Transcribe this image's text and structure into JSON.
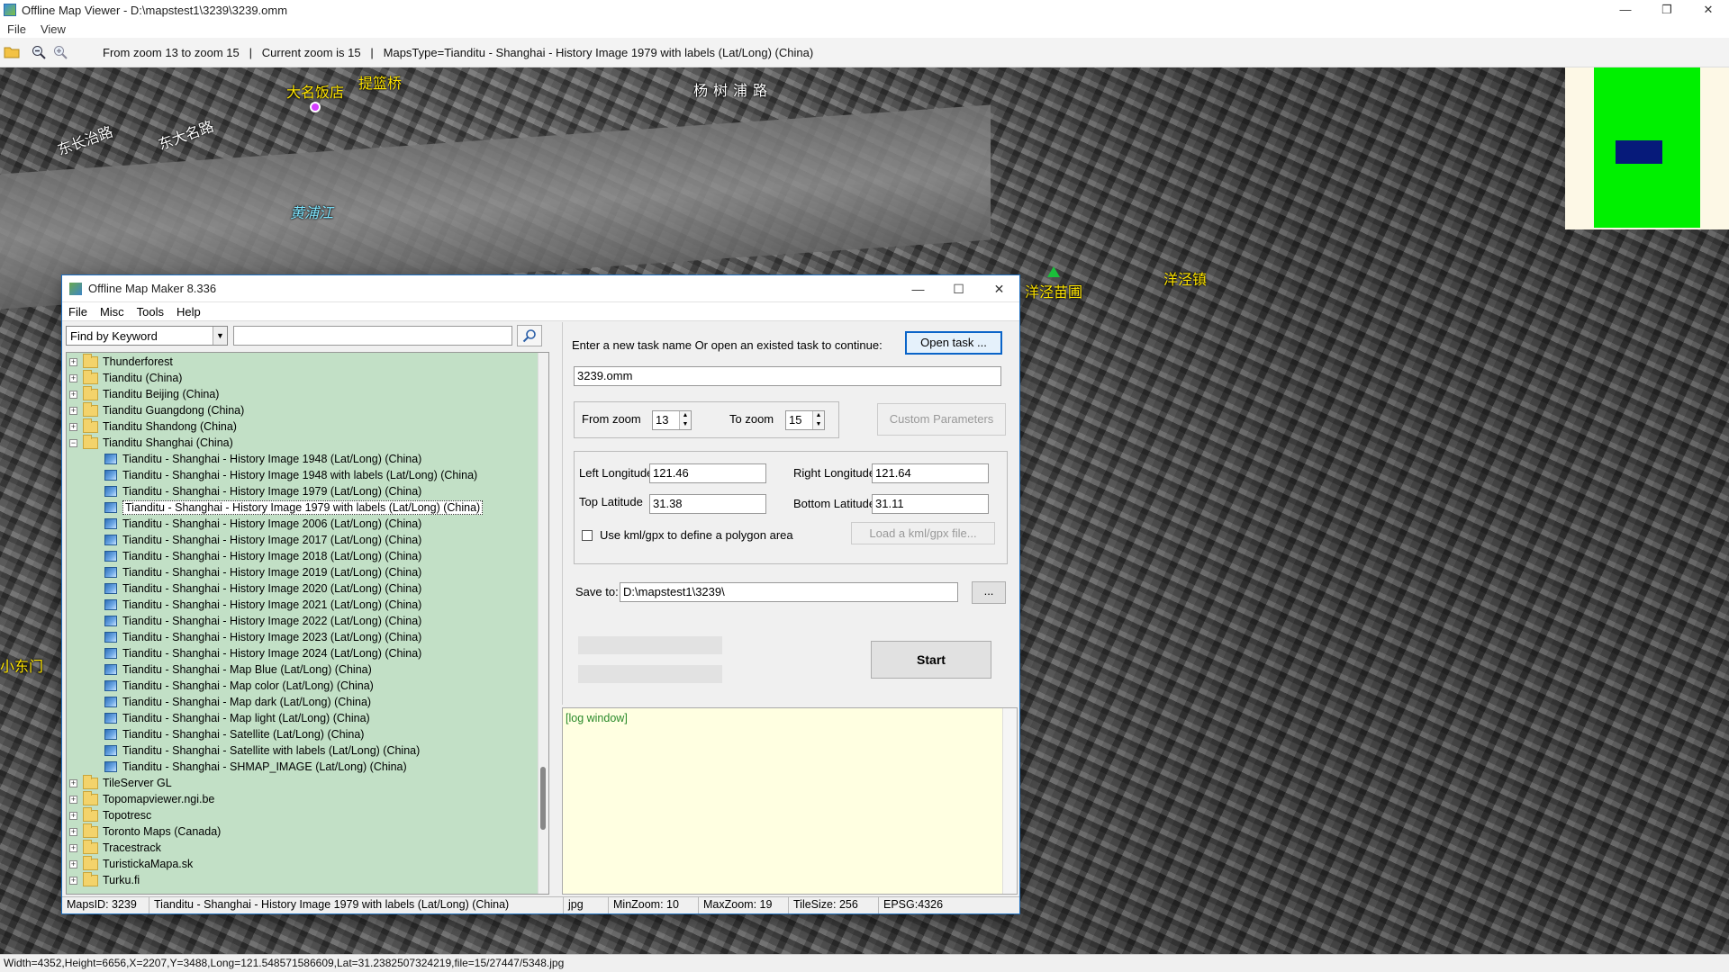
{
  "window": {
    "title": "Offline Map Viewer - D:\\mapstest1\\3239\\3239.omm",
    "controls": [
      "—",
      "❐",
      "✕"
    ]
  },
  "menubar": [
    "File",
    "View"
  ],
  "toolbar": {
    "status_text": "From zoom 13 to zoom 15   |   Current zoom is 15   |   MapsType=Tianditu - Shanghai - History Image 1979 with labels (Lat/Long) (China)"
  },
  "map": {
    "labels": [
      {
        "text": "大名饭店",
        "style": "yellow"
      },
      {
        "text": "提篮桥",
        "style": "yellow"
      },
      {
        "text": "杨树浦路",
        "style": "white"
      },
      {
        "text": "东长治路",
        "style": "white"
      },
      {
        "text": "东大名路",
        "style": "white"
      },
      {
        "text": "黄浦江",
        "style": "cyan"
      },
      {
        "text": "洋泾苗圃",
        "style": "yellow"
      },
      {
        "text": "洋泾镇",
        "style": "yellow"
      },
      {
        "text": "小东门",
        "style": "yellow"
      }
    ],
    "overview_colors": {
      "background": "#fdf8e6",
      "extent": "#00f000",
      "viewport": "#061a7a"
    }
  },
  "statusbar": {
    "text": "Width=4352,Height=6656,X=2207,Y=3488,Long=121.548571586609,Lat=31.2382507324219,file=15/27447/5348.jpg"
  },
  "dialog": {
    "title": "Offline Map Maker 8.336",
    "controls": [
      "—",
      "☐",
      "✕"
    ],
    "menu": [
      "File",
      "Misc",
      "Tools",
      "Help"
    ],
    "find": {
      "mode": "Find by Keyword",
      "query": ""
    },
    "tree": [
      {
        "label": "Thunderforest",
        "level": 0,
        "expanded": false
      },
      {
        "label": "Tianditu (China)",
        "level": 0,
        "expanded": false
      },
      {
        "label": "Tianditu Beijing (China)",
        "level": 0,
        "expanded": false
      },
      {
        "label": "Tianditu Guangdong (China)",
        "level": 0,
        "expanded": false
      },
      {
        "label": "Tianditu Shandong (China)",
        "level": 0,
        "expanded": false
      },
      {
        "label": "Tianditu Shanghai (China)",
        "level": 0,
        "expanded": true
      },
      {
        "label": "Tianditu - Shanghai - History Image 1948 (Lat/Long) (China)",
        "level": 1
      },
      {
        "label": "Tianditu - Shanghai - History Image 1948 with labels (Lat/Long) (China)",
        "level": 1
      },
      {
        "label": "Tianditu - Shanghai - History Image 1979 (Lat/Long) (China)",
        "level": 1
      },
      {
        "label": "Tianditu - Shanghai - History Image 1979 with labels (Lat/Long) (China)",
        "level": 1,
        "selected": true
      },
      {
        "label": "Tianditu - Shanghai - History Image 2006 (Lat/Long) (China)",
        "level": 1
      },
      {
        "label": "Tianditu - Shanghai - History Image 2017 (Lat/Long) (China)",
        "level": 1
      },
      {
        "label": "Tianditu - Shanghai - History Image 2018 (Lat/Long) (China)",
        "level": 1
      },
      {
        "label": "Tianditu - Shanghai - History Image 2019 (Lat/Long) (China)",
        "level": 1
      },
      {
        "label": "Tianditu - Shanghai - History Image 2020 (Lat/Long) (China)",
        "level": 1
      },
      {
        "label": "Tianditu - Shanghai - History Image 2021 (Lat/Long) (China)",
        "level": 1
      },
      {
        "label": "Tianditu - Shanghai - History Image 2022 (Lat/Long) (China)",
        "level": 1
      },
      {
        "label": "Tianditu - Shanghai - History Image 2023 (Lat/Long) (China)",
        "level": 1
      },
      {
        "label": "Tianditu - Shanghai - History Image 2024 (Lat/Long) (China)",
        "level": 1
      },
      {
        "label": "Tianditu - Shanghai - Map Blue (Lat/Long) (China)",
        "level": 1
      },
      {
        "label": "Tianditu - Shanghai - Map color (Lat/Long) (China)",
        "level": 1
      },
      {
        "label": "Tianditu - Shanghai - Map dark (Lat/Long) (China)",
        "level": 1
      },
      {
        "label": "Tianditu - Shanghai - Map light (Lat/Long) (China)",
        "level": 1
      },
      {
        "label": "Tianditu - Shanghai - Satellite (Lat/Long) (China)",
        "level": 1
      },
      {
        "label": "Tianditu - Shanghai - Satellite with labels (Lat/Long) (China)",
        "level": 1
      },
      {
        "label": "Tianditu - Shanghai - SHMAP_IMAGE (Lat/Long) (China)",
        "level": 1
      },
      {
        "label": "TileServer GL",
        "level": 0,
        "expanded": false
      },
      {
        "label": "Topomapviewer.ngi.be",
        "level": 0,
        "expanded": false
      },
      {
        "label": "Topotresc",
        "level": 0,
        "expanded": false
      },
      {
        "label": "Toronto Maps (Canada)",
        "level": 0,
        "expanded": false
      },
      {
        "label": "Tracestrack",
        "level": 0,
        "expanded": false
      },
      {
        "label": "TuristickaMapa.sk",
        "level": 0,
        "expanded": false
      },
      {
        "label": "Turku.fi",
        "level": 0,
        "expanded": false
      }
    ],
    "task": {
      "prompt": "Enter a new task name Or open an existed task to continue:",
      "open_label": "Open task ...",
      "name": "3239.omm"
    },
    "zoom": {
      "from_label": "From zoom",
      "from_value": "13",
      "to_label": "To zoom",
      "to_value": "15",
      "custom_label": "Custom Parameters"
    },
    "bounds": {
      "left_label": "Left Longitude",
      "left": "121.46",
      "right_label": "Right Longitude",
      "right": "121.64",
      "top_label": "Top Latitude",
      "top": "31.38",
      "bottom_label": "Bottom Latitude",
      "bottom": "31.11",
      "kml_label": "Use kml/gpx to define a polygon area",
      "kml_checked": false,
      "load_label": "Load a kml/gpx file..."
    },
    "save": {
      "label": "Save to:",
      "path": "D:\\mapstest1\\3239\\",
      "browse": "..."
    },
    "start_label": "Start",
    "log": "[log window]",
    "status": {
      "maps_id": "MapsID: 3239",
      "map_name": "Tianditu - Shanghai - History Image 1979 with labels (Lat/Long) (China)",
      "format": "jpg",
      "min_zoom": "MinZoom: 10",
      "max_zoom": "MaxZoom: 19",
      "tile_size": "TileSize: 256",
      "epsg": "EPSG:4326"
    }
  }
}
